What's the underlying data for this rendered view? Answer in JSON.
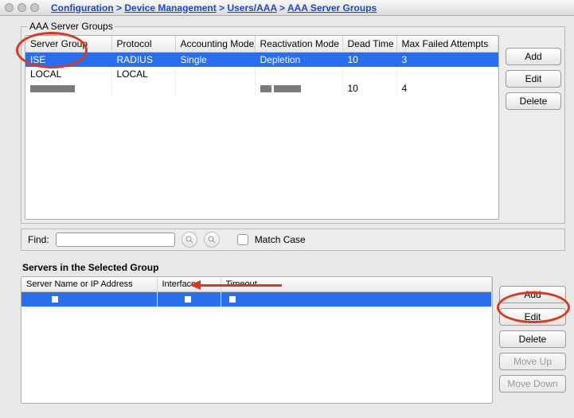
{
  "breadcrumb": {
    "part1": "Configuration",
    "part2": "Device Management",
    "part3": "Users/AAA",
    "part4": "AAA Server Groups",
    "sep": ">"
  },
  "groups_section": {
    "title": "AAA Server Groups",
    "columns": [
      "Server Group",
      "Protocol",
      "Accounting Mode",
      "Reactivation Mode",
      "Dead Time",
      "Max Failed Attempts"
    ],
    "rows": [
      {
        "selected": true,
        "cells": [
          "ISE",
          "RADIUS",
          "Single",
          "Depletion",
          "10",
          "3"
        ]
      },
      {
        "selected": false,
        "cells": [
          "LOCAL",
          "LOCAL",
          "",
          "",
          "",
          ""
        ]
      },
      {
        "selected": false,
        "redacted": true,
        "cells": [
          "",
          "",
          "",
          "",
          "10",
          "4"
        ]
      }
    ],
    "buttons": {
      "add": "Add",
      "edit": "Edit",
      "delete": "Delete"
    }
  },
  "find": {
    "label": "Find:",
    "value": "",
    "match_case": "Match Case"
  },
  "servers_section": {
    "title": "Servers in the Selected Group",
    "columns": [
      "Server Name or IP Address",
      "Interface",
      "Timeout"
    ],
    "row_selected": true,
    "buttons": {
      "add": "Add",
      "edit": "Edit",
      "delete": "Delete",
      "move_up": "Move Up",
      "move_down": "Move Down"
    }
  }
}
